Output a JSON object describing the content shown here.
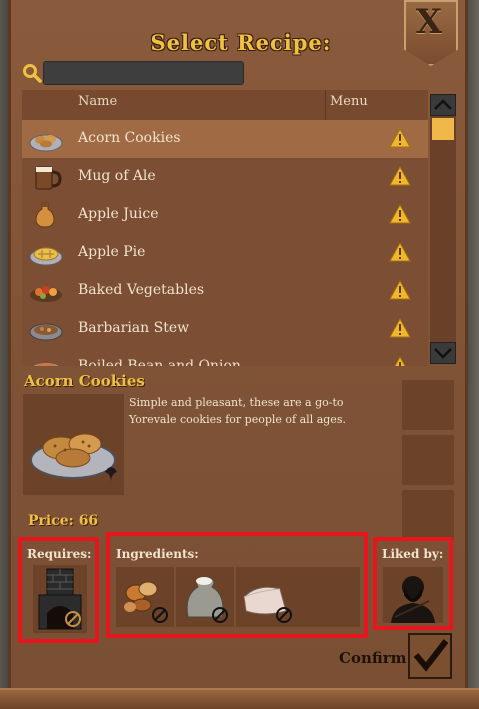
{
  "dialog": {
    "title": "Select Recipe:",
    "close_label": "X"
  },
  "search": {
    "value": "",
    "placeholder": ""
  },
  "list": {
    "columns": [
      "Name",
      "Menu"
    ],
    "rows": [
      {
        "label": "Acorn Cookies",
        "icon": "acorn-cookies-icon",
        "selected": true,
        "warning": true
      },
      {
        "label": "Mug of Ale",
        "icon": "mug-of-ale-icon",
        "selected": false,
        "warning": true
      },
      {
        "label": "Apple Juice",
        "icon": "apple-juice-icon",
        "selected": false,
        "warning": true
      },
      {
        "label": "Apple Pie",
        "icon": "apple-pie-icon",
        "selected": false,
        "warning": true
      },
      {
        "label": "Baked Vegetables",
        "icon": "baked-vegetables-icon",
        "selected": false,
        "warning": true
      },
      {
        "label": "Barbarian Stew",
        "icon": "barbarian-stew-icon",
        "selected": false,
        "warning": true
      },
      {
        "label": "Boiled Bean and Onion",
        "icon": "boiled-bean-icon",
        "selected": false,
        "warning": true
      }
    ]
  },
  "detail": {
    "title": "Acorn Cookies",
    "description": "Simple and pleasant, these are a go-to Yorevale cookies for people of all ages.",
    "price": "Price: 66",
    "requires_label": "Requires:",
    "ingredients_label": "Ingredients:",
    "liked_by_label": "Liked by:",
    "requires": [
      {
        "icon": "oven-icon",
        "available": false
      }
    ],
    "ingredients": [
      {
        "icon": "nuts-icon",
        "available": false
      },
      {
        "icon": "flour-sack-icon",
        "available": false
      },
      {
        "icon": "butter-icon",
        "available": false
      }
    ],
    "liked_by": [
      {
        "icon": "bearded-man-portrait-icon"
      }
    ]
  },
  "confirm": {
    "label": "Confirm"
  },
  "colors": {
    "accent_gold": "#f0c040",
    "highlight_red": "#e8151c",
    "panel_brown": "#7e5236",
    "warning_yellow": "#f0b828"
  }
}
